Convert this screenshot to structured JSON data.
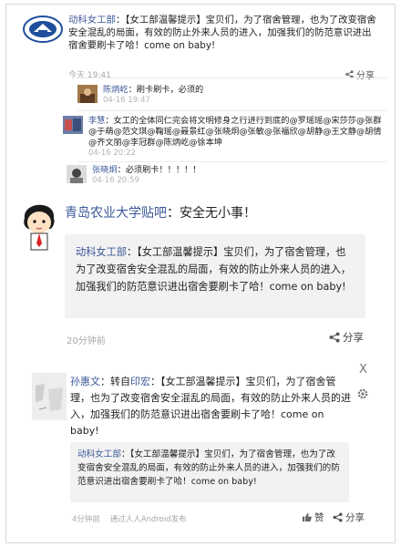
{
  "top_post": {
    "author": "动科女工部",
    "text": "：【女工部温馨提示】宝贝们，为了宿舍管理，也为了改变宿舍安全混乱的局面，有效的防止外来人员的进入，加强我们的防范意识进出宿舍要刷卡了哈！come on baby!",
    "time": "今天 19:41",
    "share_label": "分享"
  },
  "comments": [
    {
      "author": "陈炳屹",
      "text": "：刷卡刷卡，必须的",
      "time": "04-16 19:47"
    },
    {
      "author": "李慧",
      "text": "：女工的全体同仁完会将文明修身之行进行到底的@罗瑶瑶@宋莎莎@张群@于萌@范文琪@鞠瑶@聂景红@张晓炯@张敏@张福欣@胡静@王文静@胡倩@齐文丽@李冠群@陈炳屹@徐本坤",
      "time": "04-16 20:22"
    },
    {
      "author": "张晓炯",
      "text": "：必须刷卡！！！！！",
      "time": "04-16 20:59"
    }
  ],
  "middle_post": {
    "title_link": "青岛农业大学贴吧",
    "title_rest": "：安全无小事！",
    "quote_author": "动科女工部",
    "quote_text": "：【女工部温馨提示】宝贝们，为了宿舍管理，也为了改变宿舍安全混乱的局面，有效的防止外来人员的进入，加强我们的防范意识进出宿舍要刷卡了哈！come on baby!",
    "time": "20分钟前",
    "share_label": "分享"
  },
  "bottom_post": {
    "author": "孙惠文",
    "repost_prefix": "：转自",
    "repost_from": "印宏",
    "text": "：【女工部温馨提示】宝贝们，为了宿舍管理，也为了改变宿舍安全混乱的局面，有效的防止外来人员的进入，加强我们的防范意识进出宿舍要刷卡了哈！come on baby!",
    "close_glyph": "X",
    "quote_author": "动科女工部",
    "quote_text": "：【女工部温馨提示】宝贝们，为了宿舍管理，也为了改变宿舍安全混乱的局面，有效的防止外来人员的进入，加强我们的防范意识进出宿舍要刷卡了哈！come on baby!",
    "time": "4分钟前",
    "via": "通过人人Android发布",
    "like_label": "赞",
    "share_label": "分享"
  },
  "colors": {
    "link": "#3b5998",
    "muted": "#a8a8a8",
    "box_bg": "#f2f2f2"
  },
  "icons": [
    "school-logo-icon",
    "share-icon",
    "mascot-avatar-icon",
    "close-icon",
    "gear-icon",
    "like-icon"
  ]
}
